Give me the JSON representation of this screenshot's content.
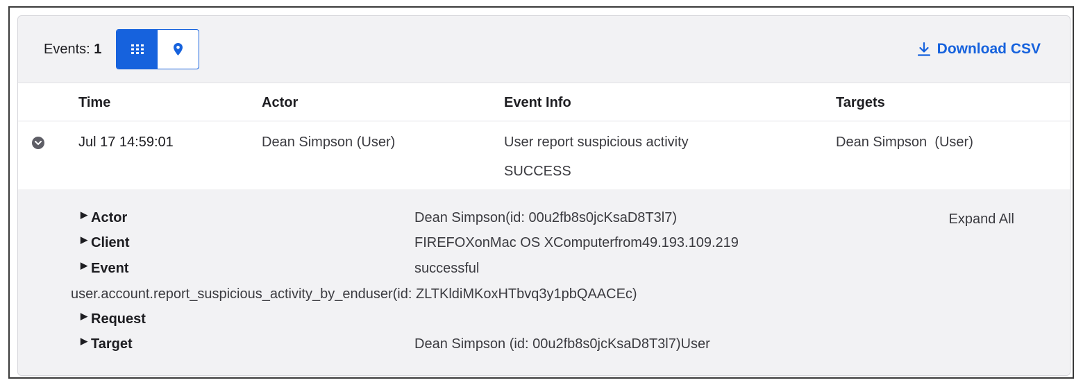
{
  "toolbar": {
    "events_label": "Events:",
    "events_count": "1",
    "download_label": "Download CSV",
    "accent_color": "#1662dd"
  },
  "table": {
    "columns": [
      "Time",
      "Actor",
      "Event Info",
      "Targets"
    ],
    "row": {
      "time": "Jul 17 14:59:01",
      "actor_name": "Dean Simpson",
      "actor_type": "(User)",
      "event_info": "User report suspicious activity",
      "event_status": "SUCCESS",
      "target_name": "Dean Simpson",
      "target_type": "(User)"
    }
  },
  "details": {
    "expand_all": "Expand All",
    "actor": {
      "label": "Actor",
      "value": "Dean Simpson(id: 00u2fb8s0jcKsaD8T3l7)"
    },
    "client": {
      "label": "Client",
      "value": "FIREFOXonMac OS XComputerfrom49.193.109.219"
    },
    "event": {
      "label": "Event",
      "value": "successful",
      "detail": "user.account.report_suspicious_activity_by_enduser(id: ZLTKldiMKoxHTbvq3y1pbQAACEc)"
    },
    "request": {
      "label": "Request"
    },
    "target": {
      "label": "Target",
      "value": "Dean Simpson (id: 00u2fb8s0jcKsaD8T3l7)User"
    }
  }
}
